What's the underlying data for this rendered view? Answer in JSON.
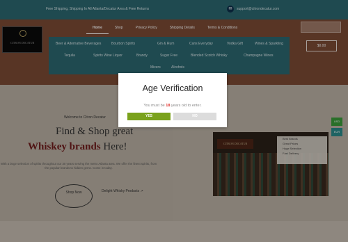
{
  "topbar": {
    "shipping_text": "Free Shipping, Shipping In All Atlanta/Decatur Area & Free Returns",
    "email_icon": "envelope-icon",
    "email_text": "support@citrondecatur.com"
  },
  "logo": {
    "text": "CITRON DECATUR"
  },
  "main_nav": [
    "Home",
    "Shop",
    "Privacy Policy",
    "Shipping Details",
    "Terms & Conditions"
  ],
  "cart": {
    "label": "$0.00"
  },
  "categories": [
    "Beer & Alternative Beverages",
    "Bourbon Spirits",
    "Gin & Rum",
    "Cans Everyday",
    "Vodka Gift",
    "Wines & Sparkling",
    "Tequila",
    "Spirits Wine Liquor",
    "Brandy",
    "Sugar Free",
    "Blended Scotch Whisky",
    "Champagne Wines",
    "Mixers",
    "Alcohols"
  ],
  "hero": {
    "welcome": "Welcome to Citron Decatur",
    "headline_line1": "Find & Shop great",
    "headline_highlight": "Whiskey brands",
    "headline_end": " Here!",
    "paragraph": "With a large selection of spirits throughout our 30 years serving the metro Atlanta area. We offer the finest spirits, from the popular brands to hidden gems. Come in today.",
    "shop_button": "Shop Now",
    "secondary_link": "Delight Whisky Products",
    "store_sign": "CITRON DECATUR",
    "store_card": [
      "Best Brands",
      "Great Prices",
      "Huge Selection",
      "Fast Delivery"
    ]
  },
  "currency": {
    "usd": "USD",
    "eur": "EUR"
  },
  "modal": {
    "title": "Age Verification",
    "message_before": "You must be ",
    "age": "18",
    "message_after": " years old to enter.",
    "yes_label": "YES",
    "no_label": "NO"
  }
}
